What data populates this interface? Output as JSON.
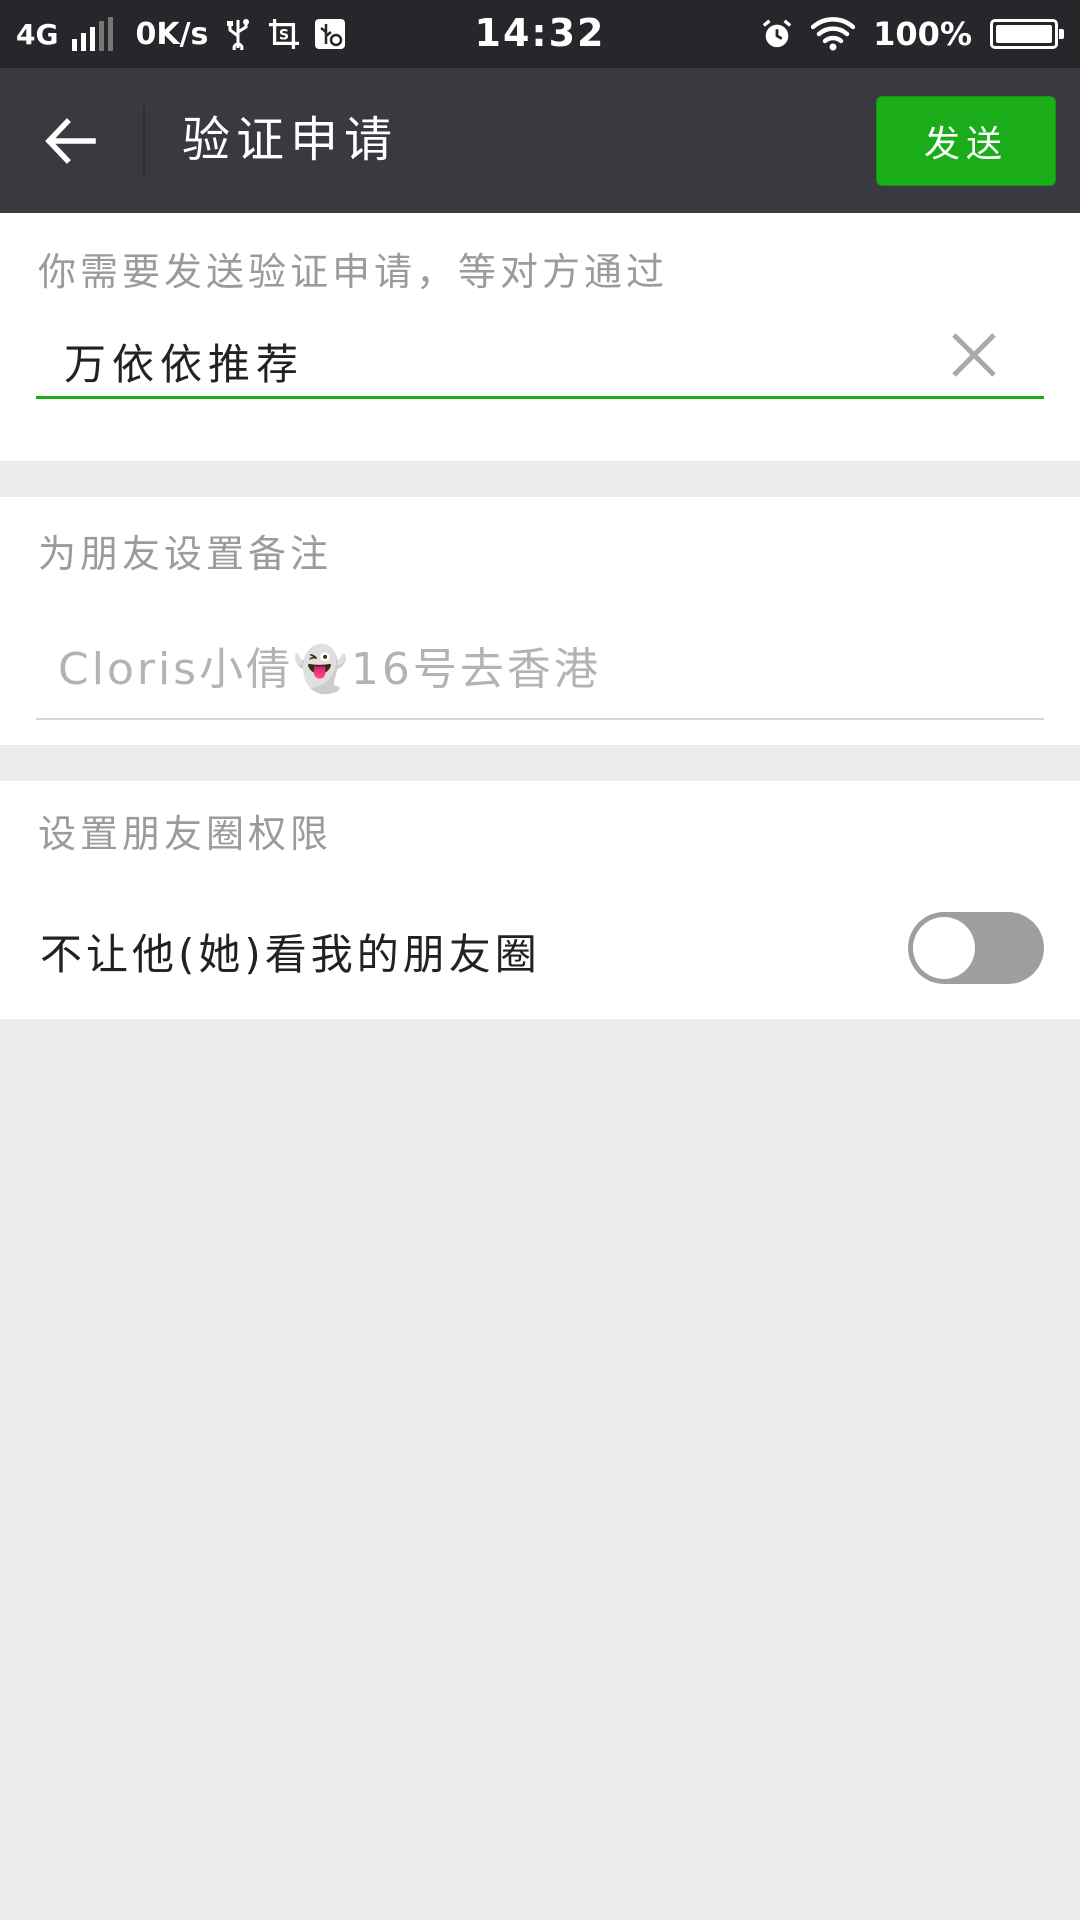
{
  "status_bar": {
    "network": "4G",
    "speed": "0K/s",
    "time": "14:32",
    "battery": "100%",
    "icons": [
      "signal-icon",
      "usb-icon",
      "screenshot-icon",
      "usb-debug-icon",
      "alarm-icon",
      "wifi-icon",
      "battery-icon"
    ]
  },
  "header": {
    "title": "验证申请",
    "send_label": "发送",
    "back_icon": "arrow-left-icon"
  },
  "verify_section": {
    "label": "你需要发送验证申请，等对方通过",
    "value": "万依依推荐",
    "clear_icon": "close-icon"
  },
  "remark_section": {
    "label": "为朋友设置备注",
    "placeholder": "Cloris小倩👻16号去香港"
  },
  "moments_section": {
    "label": "设置朋友圈权限",
    "toggle_label": "不让他(她)看我的朋友圈",
    "toggle_on": false
  },
  "colors": {
    "accent": "#1aad19",
    "header_bg": "#393a3f",
    "statusbar_bg": "#26272b",
    "page_bg": "#ebebeb",
    "focus_underline": "#1aad19",
    "toggle_off": "#9e9e9e"
  }
}
